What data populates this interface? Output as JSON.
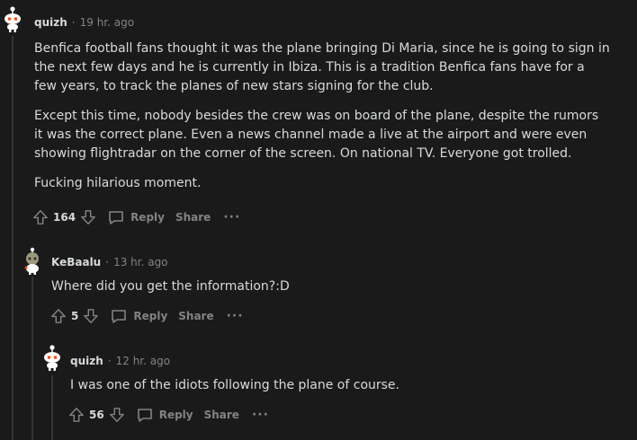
{
  "comments": [
    {
      "username": "quizh",
      "separator": "·",
      "age": "19 hr. ago",
      "paragraphs": [
        "Benfica football fans thought it was the plane bringing Di Maria, since he is going to sign in the next few days and he is currently in Ibiza. This is a tradition Benfica fans have for a few years, to track the planes of new stars signing for the club.",
        "Except this time, nobody besides the crew was on board of the plane, despite the rumors it was the correct plane. Even a news channel made a live at the airport and were even showing flightradar on the corner of the screen. On national TV. Everyone got trolled.",
        "Fucking hilarious moment."
      ],
      "votes": "164",
      "reply_label": "Reply",
      "share_label": "Share",
      "more_label": "···"
    },
    {
      "username": "KeBaalu",
      "separator": "·",
      "age": "13 hr. ago",
      "paragraphs": [
        "Where did you get the information?:D"
      ],
      "votes": "5",
      "reply_label": "Reply",
      "share_label": "Share",
      "more_label": "···"
    },
    {
      "username": "quizh",
      "separator": "·",
      "age": "12 hr. ago",
      "paragraphs": [
        "I was one of the idiots following the plane of course."
      ],
      "votes": "56",
      "reply_label": "Reply",
      "share_label": "Share",
      "more_label": "···"
    }
  ],
  "icons": {
    "upvote": "upvote-icon",
    "downvote": "downvote-icon",
    "reply": "comment-bubble-icon",
    "avatar": "snoo-avatar-icon"
  },
  "colors": {
    "background": "#1a1a1b",
    "text": "#d7dadc",
    "muted": "#818384",
    "thread_line": "#343536",
    "avatar_accent": "#ff4500"
  }
}
